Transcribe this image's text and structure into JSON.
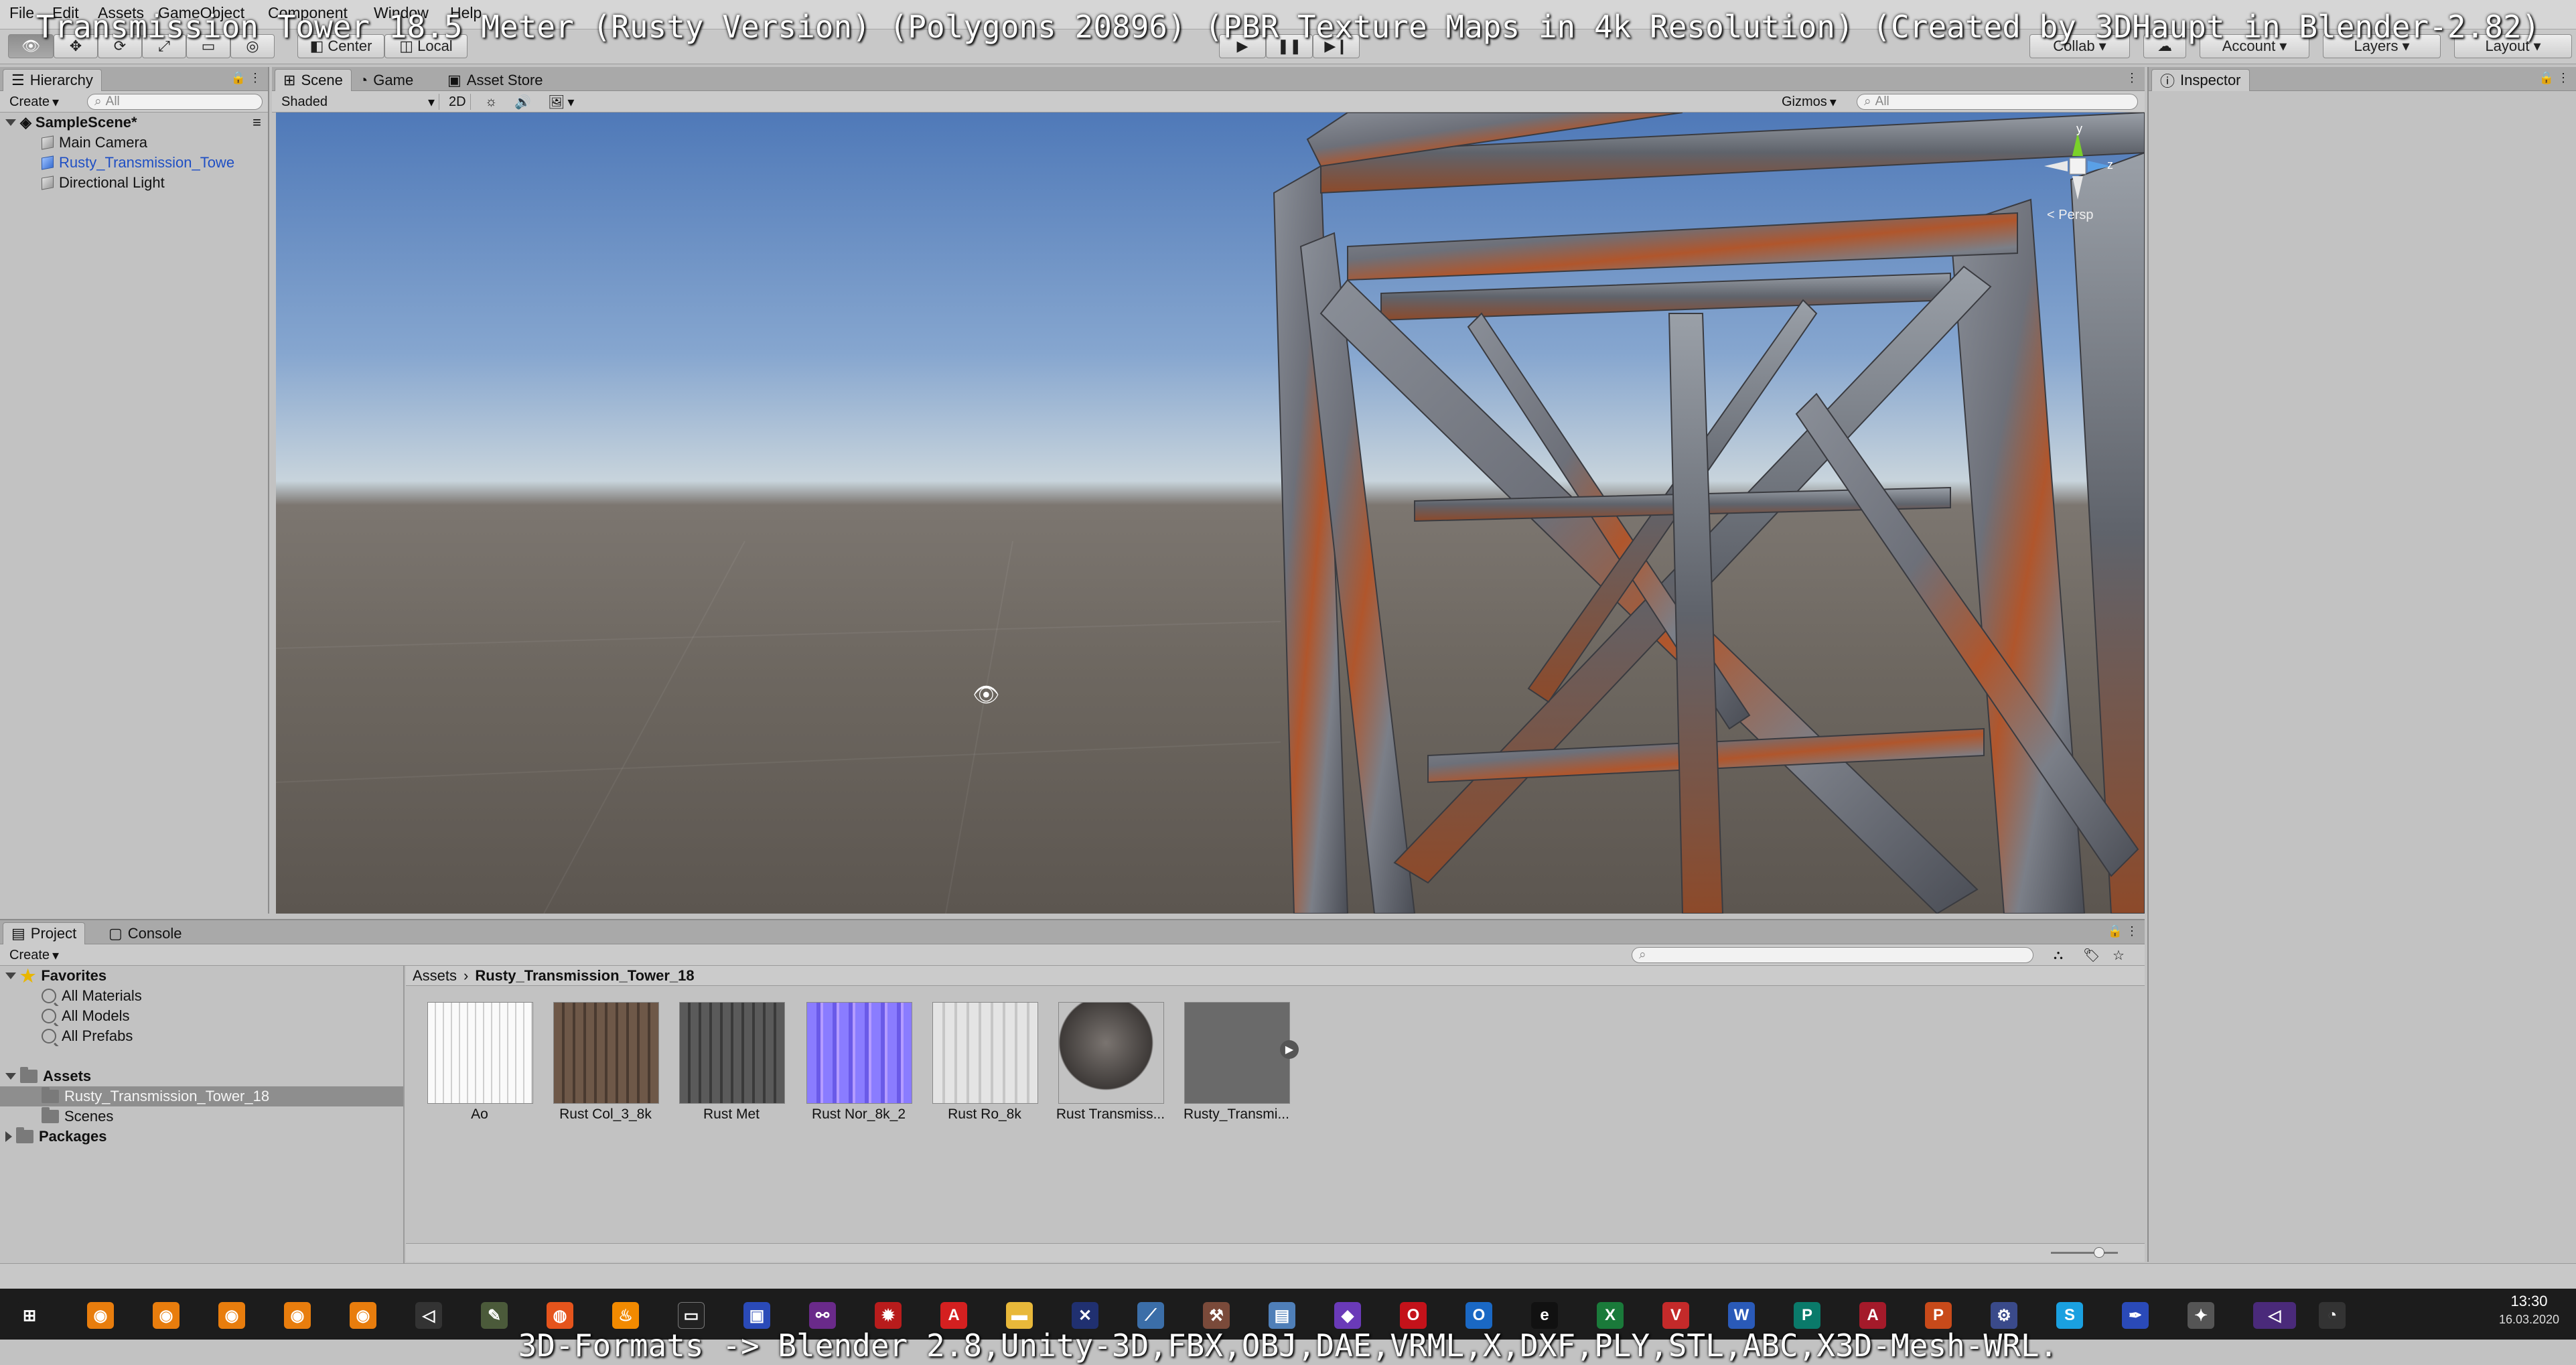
{
  "overlay": {
    "title": "Transmission Tower 18.5 Meter (Rusty Version) (Polygons 20896) (PBR Texture Maps in 4k Resolution) (Created by 3DHaupt in Blender-2.82)",
    "bottom_caption": "3D-Formats -> Blender 2.8,Unity-3D,FBX,OBJ,DAE,VRML,X,DXF,PLY,STL,ABC,X3D-Mesh-WRL."
  },
  "menu": [
    "File",
    "Edit",
    "Assets",
    "GameObject",
    "Component",
    "Window",
    "Help"
  ],
  "toolbar": {
    "pivot": "Center",
    "space": "Local",
    "collab": "Collab",
    "account": "Account",
    "layers": "Layers",
    "layout": "Layout"
  },
  "hierarchy": {
    "tab": "Hierarchy",
    "create": "Create",
    "search_placeholder": "All",
    "scene": "SampleScene*",
    "items": [
      {
        "label": "Main Camera",
        "selected": false
      },
      {
        "label": "Rusty_Transmission_Towe",
        "selected": true
      },
      {
        "label": "Directional Light",
        "selected": false
      }
    ]
  },
  "scene": {
    "tabs": [
      "Scene",
      "Game",
      "Asset Store"
    ],
    "shading": "Shaded",
    "mode_2d": "2D",
    "gizmos": "Gizmos",
    "search_placeholder": "All",
    "persp": "< Persp",
    "axis_y": "y",
    "axis_z": "z"
  },
  "inspector": {
    "tab": "Inspector"
  },
  "project": {
    "tabs": [
      "Project",
      "Console"
    ],
    "create": "Create",
    "favorites_label": "Favorites",
    "favorites": [
      "All Materials",
      "All Models",
      "All Prefabs"
    ],
    "assets_label": "Assets",
    "assets_children": [
      "Rusty_Transmission_Tower_18",
      "Scenes"
    ],
    "packages_label": "Packages",
    "breadcrumb_root": "Assets",
    "breadcrumb_current": "Rusty_Transmission_Tower_18",
    "thumbnails": [
      {
        "label": "Ao",
        "color": "#eeeeee"
      },
      {
        "label": "Rust Col_3_8k",
        "color": "#6e5848"
      },
      {
        "label": "Rust Met",
        "color": "#505050"
      },
      {
        "label": "Rust Nor_8k_2",
        "color": "#7a6cf0"
      },
      {
        "label": "Rust Ro_8k",
        "color": "#dcdcdc"
      },
      {
        "label": "Rust Transmiss...",
        "color": "#4a4644"
      },
      {
        "label": "Rusty_Transmi...",
        "color": "#6a6a6a"
      }
    ]
  },
  "taskbar": {
    "time": "13:30",
    "date": "16.03.2020"
  }
}
